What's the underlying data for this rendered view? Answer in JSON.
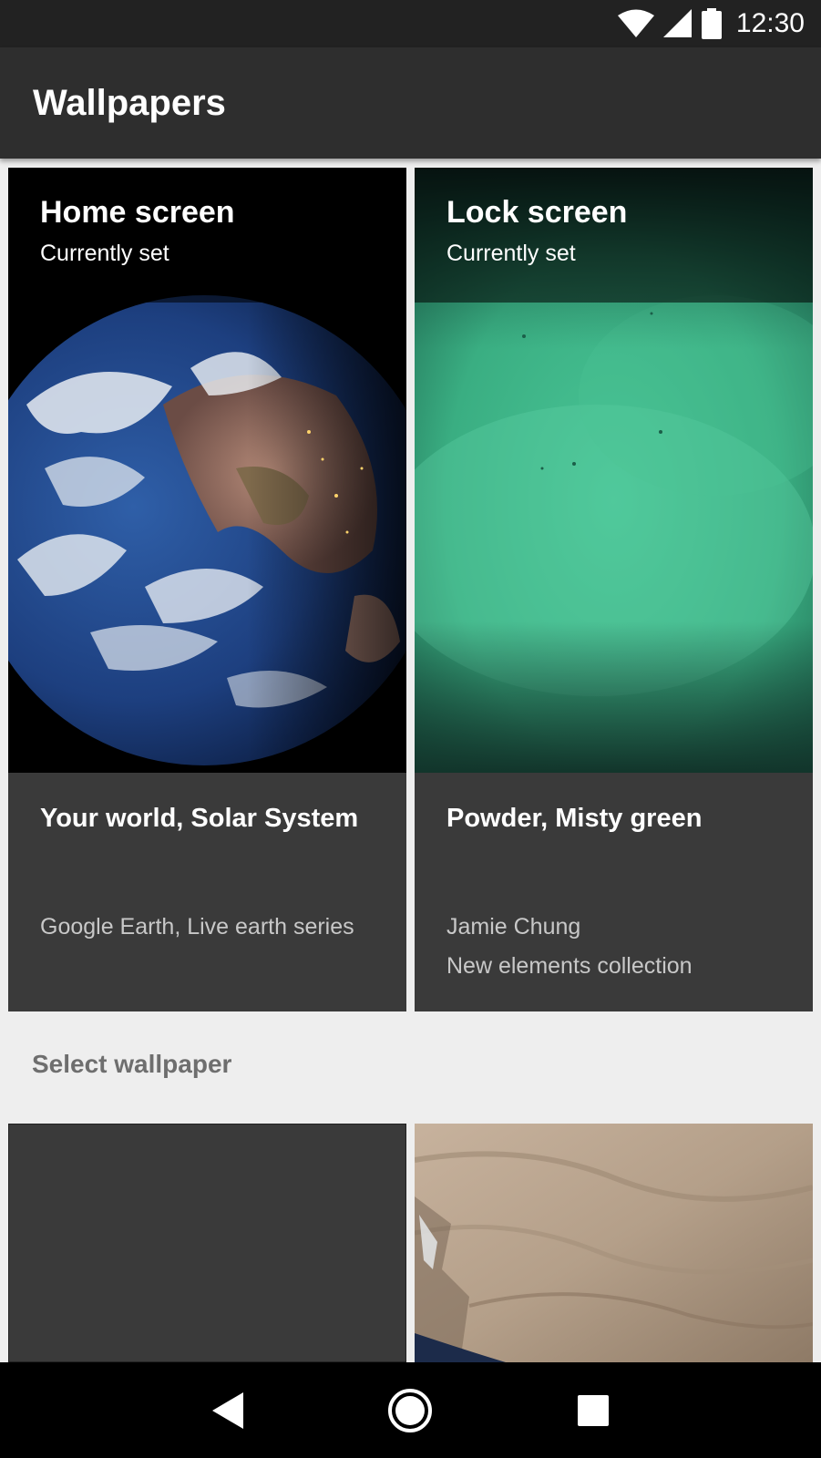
{
  "status_bar": {
    "time": "12:30",
    "icons": [
      "wifi-icon",
      "cell-signal-icon",
      "battery-icon"
    ]
  },
  "app_bar": {
    "title": "Wallpapers"
  },
  "current_wallpapers": [
    {
      "screen": "Home screen",
      "status": "Currently set",
      "title": "Your world, Solar System",
      "attribution": [
        "Google Earth, Live earth series"
      ]
    },
    {
      "screen": "Lock screen",
      "status": "Currently set",
      "title": "Powder, Misty green",
      "attribution": [
        "Jamie Chung",
        "New elements collection"
      ]
    }
  ],
  "select_section": {
    "label": "Select wallpaper"
  },
  "nav_bar": {
    "icons": [
      "back-icon",
      "home-icon",
      "recents-icon"
    ]
  },
  "colors": {
    "status_bar": "#222222",
    "app_bar": "#2e2e2e",
    "card_bg": "#3a3a3a",
    "page_bg": "#eeeeee",
    "lock_green": "#3fbf8e"
  }
}
